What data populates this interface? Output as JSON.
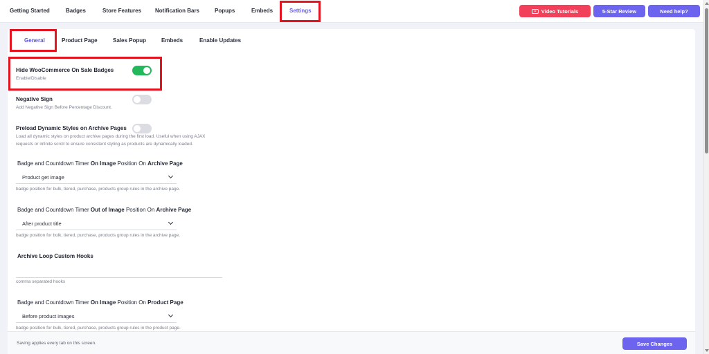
{
  "top_nav": {
    "items": [
      "Getting Started",
      "Badges",
      "Store Features",
      "Notification Bars",
      "Popups",
      "Embeds",
      "Settings"
    ],
    "active": "Settings"
  },
  "header_buttons": {
    "video_tutorials": "Video Tutorials",
    "star_review": "5-Star Review",
    "need_help": "Need help?"
  },
  "sub_tabs": {
    "items": [
      "General",
      "Product Page",
      "Sales Popup",
      "Embeds",
      "Enable Updates"
    ],
    "active": "General"
  },
  "settings": {
    "hide_sale_badges": {
      "title": "Hide WooCommerce On Sale Badges",
      "desc": "Enable/Disable",
      "enabled": true
    },
    "negative_sign": {
      "title": "Negative Sign",
      "desc": "Add Negative Sign Before Percentage Discount.",
      "enabled": false
    },
    "preload_styles": {
      "title": "Preload Dynamic Styles on Archive Pages",
      "desc": "Load all dynamic styles on product archive pages during the first load. Useful when using AJAX requests or infinite scroll to ensure consistent styling as products are dynamically loaded.",
      "enabled": false
    }
  },
  "sections": {
    "archive_on_image": {
      "t1": "Badge and Countdown Timer ",
      "t2": "On Image",
      "t3": " Position On ",
      "t4": "Archive Page",
      "value": "Product get image",
      "hint": "badge position for bulk, tiered, purchase, products group rules in the archive page."
    },
    "archive_out_image": {
      "t1": "Badge and Countdown Timer ",
      "t2": "Out of Image",
      "t3": " Position On ",
      "t4": "Archive Page",
      "value": "After product title",
      "hint": "badge position for bulk, tiered, purchase, products group rules in the archive page."
    },
    "custom_hooks": {
      "title": "Archive Loop Custom Hooks",
      "value": "",
      "hint": "comma separated hooks"
    },
    "product_on_image": {
      "t1": "Badge and Countdown Timer ",
      "t2": "On Image",
      "t3": " Position On ",
      "t4": "Product Page",
      "value": "Before product images",
      "hint": "badge position for bulk, tiered, purchase, products group rules in the product page."
    }
  },
  "footer": {
    "note": "Saving applies every tab on this screen.",
    "save_label": "Save Changes"
  },
  "colors": {
    "accent": "#6c63ef",
    "danger": "#f2405a",
    "toggle_on": "#23b85c",
    "highlight": "#e1141f"
  }
}
